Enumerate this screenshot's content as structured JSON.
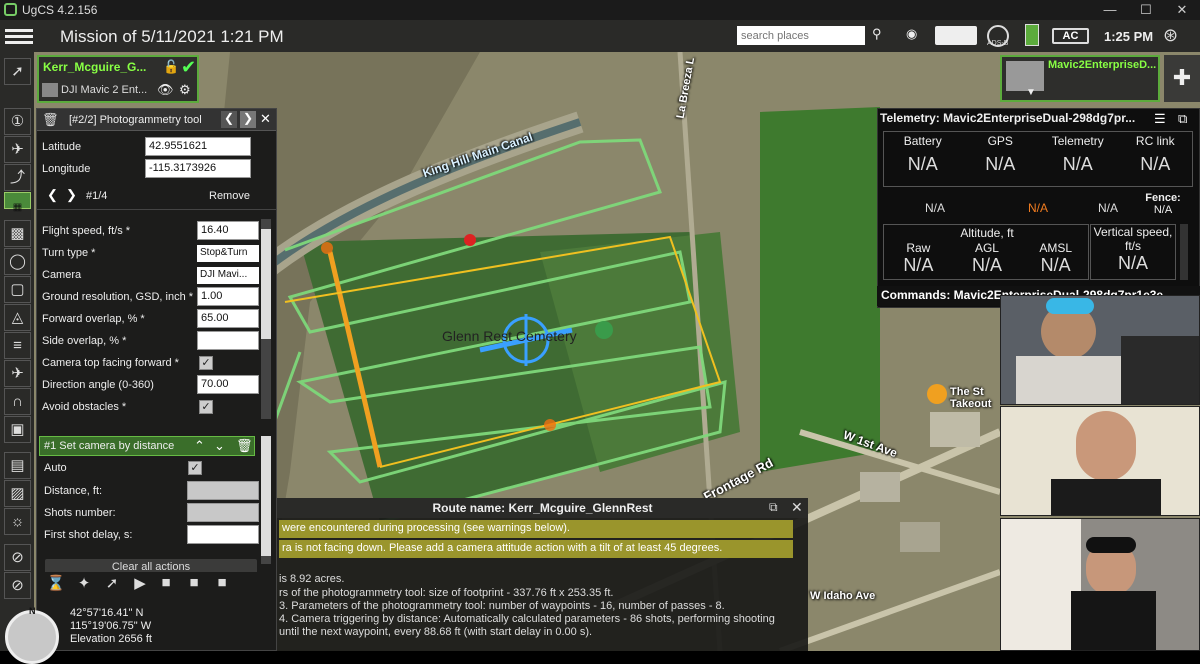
{
  "window": {
    "title": "UgCS 4.2.156"
  },
  "topbar": {
    "mission_title": "Mission of 5/11/2021 1:21 PM",
    "search_placeholder": "search places",
    "ads_b_label": "ADS-B",
    "ac_label": "AC",
    "time": "1:25 PM"
  },
  "route_card": {
    "name": "Kerr_Mcguire_G...",
    "drone": "DJI Mavic 2 Ent..."
  },
  "photogrammetry": {
    "header": "[#2/2] Photogrammetry tool",
    "latitude_label": "Latitude",
    "latitude": "42.9551621",
    "longitude_label": "Longitude",
    "longitude": "-115.3173926",
    "point_index": "#1/4",
    "remove_label": "Remove",
    "params": [
      {
        "label": "Flight speed, ft/s *",
        "value": "16.40",
        "kind": "input"
      },
      {
        "label": "Turn type *",
        "value": "Stop&Turn",
        "kind": "select"
      },
      {
        "label": "Camera",
        "value": "DJI Mavi...",
        "kind": "select"
      },
      {
        "label": "Ground resolution, GSD, inch *",
        "value": "1.00",
        "kind": "input"
      },
      {
        "label": "Forward overlap, % *",
        "value": "65.00",
        "kind": "input"
      },
      {
        "label": "Side overlap, % *",
        "value": "",
        "kind": "input"
      },
      {
        "label": "Camera top facing forward *",
        "value": "✓",
        "kind": "check"
      },
      {
        "label": "Direction angle (0-360)",
        "value": "70.00",
        "kind": "input"
      },
      {
        "label": "Avoid obstacles *",
        "value": "✓",
        "kind": "check"
      }
    ],
    "camera_action": {
      "title": "#1 Set camera by distance",
      "auto_label": "Auto",
      "auto_value": "✓",
      "distance_label": "Distance, ft:",
      "shots_label": "Shots number:",
      "delay_label": "First shot delay, s:"
    },
    "clear_all_label": "Clear all actions"
  },
  "route_report": {
    "title": "Route name: Kerr_Mcguire_GlennRest",
    "warning1": "were encountered during processing (see warnings below).",
    "warning2": "ra is not facing down. Please add a camera attitude action with a tilt of at least 45 degrees.",
    "line1": "is 8.92 acres.",
    "line2": "rs of the photogrammetry tool: size of footprint - 337.76 ft x 253.35 ft.",
    "line3": "3. Parameters of the photogrammetry tool: number of waypoints - 16, number of passes - 8.",
    "line4": "4. Camera triggering by distance: Automatically calculated parameters - 86 shots, performing shooting until the next waypoint, every 88.68 ft (with start delay in 0.00 s)."
  },
  "telemetry": {
    "title": "Telemetry: Mavic2EnterpriseDual-298dg7pr...",
    "row1_labels": [
      "Battery",
      "GPS",
      "Telemetry",
      "RC link"
    ],
    "row1_values": [
      "N/A",
      "N/A",
      "N/A",
      "N/A"
    ],
    "mid_values": [
      "N/A",
      "N/A",
      "N/A"
    ],
    "fence_label": "Fence:",
    "fence_value": "N/A",
    "altitude_label": "Altitude, ft",
    "alt_labels": [
      "Raw",
      "AGL",
      "AMSL"
    ],
    "alt_values": [
      "N/A",
      "N/A",
      "N/A"
    ],
    "vspeed_label": "Vertical speed, ft/s",
    "vspeed_value": "N/A",
    "commands": "Commands: Mavic2EnterpriseDual-298dg7pr1e3e"
  },
  "drone_card": {
    "name": "Mavic2EnterpriseD..."
  },
  "map_labels": {
    "canal": "King Hill Main Canal",
    "la_breeza": "La Breeza L",
    "cemetery": "Glenn Rest Cemetery",
    "w1st": "W 1st Ave",
    "frontage": "Frontage Rd",
    "idaho": "W Idaho Ave",
    "takeout": "The St Takeout"
  },
  "coords": {
    "lat": "42°57'16.41\" N",
    "lon": "115°19'06.75\" W",
    "elev": "Elevation 2656 ft"
  },
  "colors": {
    "accent_green": "#5cab3c",
    "warning_yellow": "#9a952c",
    "route_orange": "#f0a020",
    "route_green": "#7ed87a"
  }
}
